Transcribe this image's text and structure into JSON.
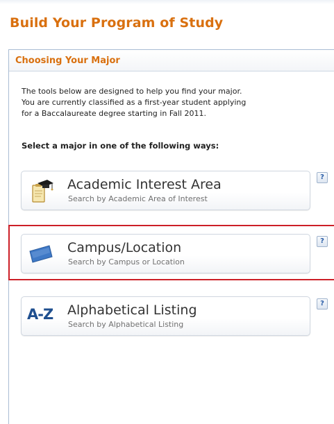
{
  "page": {
    "title": "Build Your Program of Study"
  },
  "panel": {
    "title": "Choosing Your Major",
    "intro_lines": [
      "The tools below are designed to help you find your major.",
      "You are currently classified as a first-year student applying",
      "for a Baccalaureate degree starting in Fall 2011."
    ],
    "instruction": "Select a major in one of the following ways:"
  },
  "options": [
    {
      "label": "Academic Interest Area",
      "sublabel": "Search by Academic Area of Interest",
      "icon": "clipboard-graduation-cap-icon",
      "help": "?"
    },
    {
      "label": "Campus/Location",
      "sublabel": "Search by Campus or Location",
      "icon": "blue-pennant-flag-icon",
      "help": "?"
    },
    {
      "label": "Alphabetical Listing",
      "sublabel": "Search by Alphabetical Listing",
      "icon": "a-z-icon",
      "icon_text": "A-Z",
      "help": "?"
    }
  ],
  "colors": {
    "title_orange": "#d9700f",
    "panel_border": "#a9bcd3",
    "highlight_red": "#cc1f27",
    "az_blue": "#1f4f8f"
  }
}
